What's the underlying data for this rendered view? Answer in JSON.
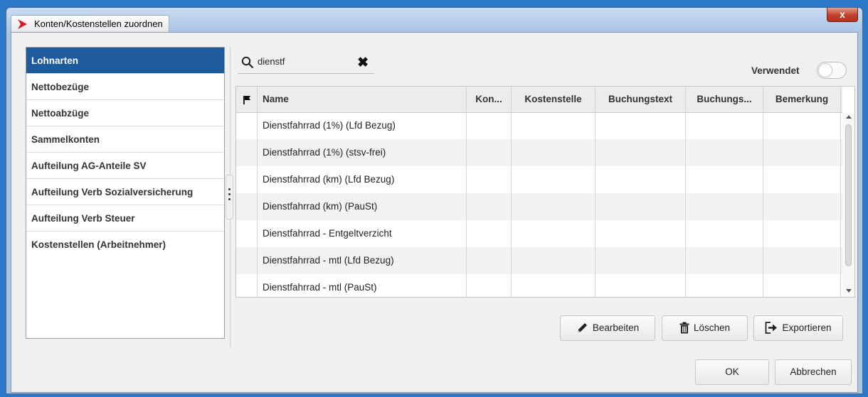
{
  "window": {
    "title": "Konten/Kostenstellen zuordnen",
    "close_label": "x"
  },
  "sidebar": {
    "items": [
      {
        "label": "Lohnarten",
        "selected": true
      },
      {
        "label": "Nettobezüge"
      },
      {
        "label": "Nettoabzüge"
      },
      {
        "label": "Sammelkonten"
      },
      {
        "label": "Aufteilung AG-Anteile SV"
      },
      {
        "label": "Aufteilung Verb Sozialversicherung"
      },
      {
        "label": "Aufteilung Verb Steuer"
      },
      {
        "label": "Kostenstellen (Arbeitnehmer)"
      }
    ]
  },
  "search": {
    "value": "dienstf",
    "icon": "search-icon",
    "clear_icon": "close-icon",
    "clear_symbol": "✖"
  },
  "filter": {
    "verwendet_label": "Verwendet",
    "verwendet_on": false
  },
  "table": {
    "columns": [
      "Name",
      "Kon...",
      "Kostenstelle",
      "Buchungstext",
      "Buchungs...",
      "Bemerkung"
    ],
    "rows": [
      {
        "name": "Dienstfahrrad (1%) (Lfd Bezug)"
      },
      {
        "name": "Dienstfahrrad (1%) (stsv-frei)"
      },
      {
        "name": "Dienstfahrrad (km) (Lfd Bezug)"
      },
      {
        "name": "Dienstfahrrad (km) (PauSt)"
      },
      {
        "name": "Dienstfahrrad - Entgeltverzicht"
      },
      {
        "name": "Dienstfahrrad - mtl (Lfd Bezug)"
      },
      {
        "name": "Dienstfahrrad - mtl (PauSt)"
      }
    ]
  },
  "actions": {
    "edit_label": "Bearbeiten",
    "delete_label": "Löschen",
    "export_label": "Exportieren"
  },
  "footer": {
    "ok_label": "OK",
    "cancel_label": "Abbrechen"
  },
  "colors": {
    "accent": "#1d5b9c",
    "brand_red": "#d51c2a"
  }
}
